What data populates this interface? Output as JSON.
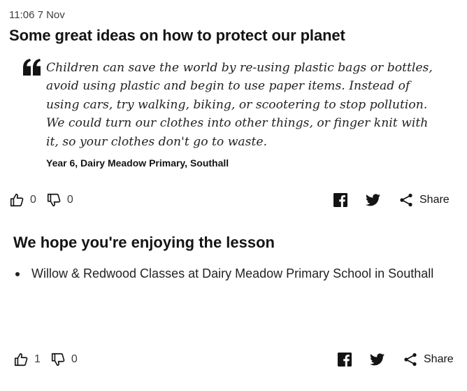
{
  "post1": {
    "timestamp": "11:06 7 Nov",
    "title": "Some great ideas on how to protect our planet",
    "quote": "Children can save the world by re-using plastic bags or bottles, avoid using plastic and begin to use paper items. Instead of using cars, try walking, biking, or scootering to stop pollution. We could turn our clothes into other things, or finger knit with it, so your clothes don't go to waste.",
    "source": "Year 6, Dairy Meadow Primary, Southall",
    "likes": "0",
    "dislikes": "0",
    "share_label": "Share"
  },
  "post2": {
    "title": "We hope you're enjoying the lesson",
    "items": [
      "Willow & Redwood Classes at Dairy Meadow Primary School in Southall"
    ],
    "likes": "1",
    "dislikes": "0",
    "share_label": "Share"
  },
  "icons": {
    "like": "thumbs-up-icon",
    "dislike": "thumbs-down-icon",
    "facebook": "facebook-icon",
    "twitter": "twitter-icon",
    "share": "share-icon",
    "quote": "quote-mark-icon"
  },
  "colors": {
    "text": "#141414",
    "secondary_text": "#3f3f42",
    "quote_mark": "#141414"
  }
}
